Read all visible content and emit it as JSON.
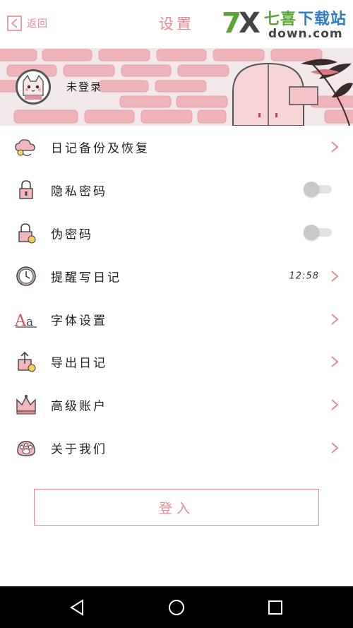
{
  "header": {
    "back_label": "返回",
    "title": "设置",
    "watermark_brand": "7X七喜下载站",
    "watermark_domain": "down.com"
  },
  "profile": {
    "status": "未登录",
    "avatar_icon": "cat-avatar-icon"
  },
  "menu": [
    {
      "label": "日记备份及恢复",
      "icon": "cloud-backup-icon",
      "control": "chevron"
    },
    {
      "label": "隐私密码",
      "icon": "lock-icon",
      "control": "toggle",
      "on": false
    },
    {
      "label": "伪密码",
      "icon": "fake-lock-icon",
      "control": "toggle",
      "on": false
    },
    {
      "label": "提醒写日记",
      "icon": "clock-icon",
      "control": "chevron",
      "value": "12:58"
    },
    {
      "label": "字体设置",
      "icon": "font-icon",
      "control": "chevron"
    },
    {
      "label": "导出日记",
      "icon": "export-icon",
      "control": "chevron"
    },
    {
      "label": "高级账户",
      "icon": "crown-icon",
      "control": "chevron"
    },
    {
      "label": "关于我们",
      "icon": "paw-icon",
      "control": "chevron"
    }
  ],
  "login_button": "登入",
  "colors": {
    "accent": "#e58a94",
    "brick": "#eeb4ba",
    "navbar": "#000000"
  }
}
